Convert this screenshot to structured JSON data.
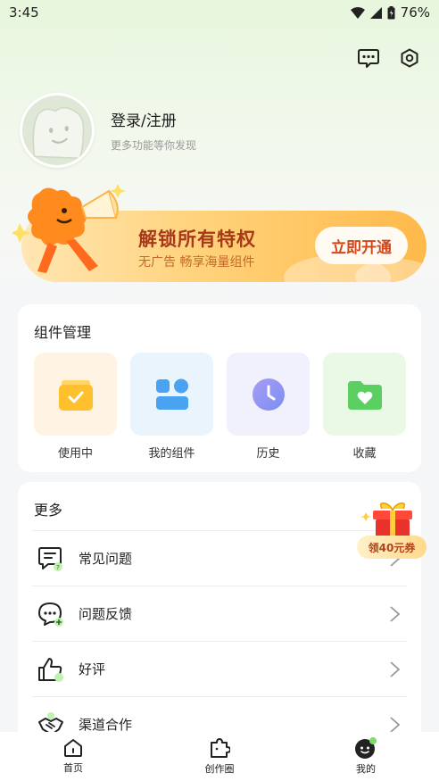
{
  "status_bar": {
    "time": "3:45",
    "battery": "76%"
  },
  "profile": {
    "title": "登录/注册",
    "subtitle": "更多功能等你发现"
  },
  "vip_banner": {
    "title": "解锁所有特权",
    "subtitle": "无广告 畅享海量组件",
    "button": "立即开通"
  },
  "widgets": {
    "title": "组件管理",
    "items": [
      {
        "label": "使用中",
        "icon": "in-use-folder-icon",
        "bg": "#fff3e3"
      },
      {
        "label": "我的组件",
        "icon": "my-widgets-icon",
        "bg": "#eaf4fd"
      },
      {
        "label": "历史",
        "icon": "history-clock-icon",
        "bg": "#f1f0fd"
      },
      {
        "label": "收藏",
        "icon": "favorites-heart-folder-icon",
        "bg": "#eaf8e6"
      }
    ]
  },
  "more": {
    "title": "更多",
    "items": [
      {
        "label": "常见问题",
        "icon": "faq-icon"
      },
      {
        "label": "问题反馈",
        "icon": "feedback-icon"
      },
      {
        "label": "好评",
        "icon": "thumbs-up-icon"
      },
      {
        "label": "渠道合作",
        "icon": "handshake-icon"
      }
    ]
  },
  "gift": {
    "label": "领40元券"
  },
  "nav": {
    "items": [
      {
        "label": "首页"
      },
      {
        "label": "创作圈"
      },
      {
        "label": "我的"
      }
    ]
  },
  "colors": {
    "accent": "#ffb94a",
    "vip_text": "#a7381a",
    "bg": "#f5f6f8"
  }
}
